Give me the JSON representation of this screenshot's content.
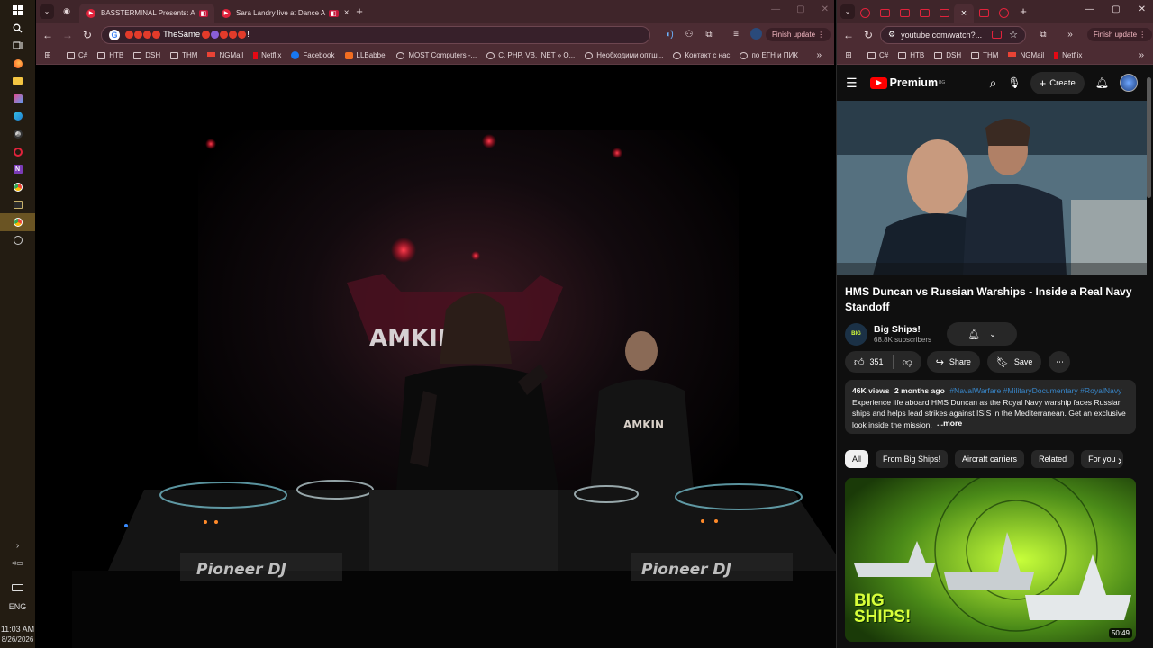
{
  "taskbar": {
    "icons": [
      "windows-start-icon",
      "search-icon",
      "task-view-icon",
      "firefox-icon",
      "file-explorer-icon",
      "photos-icon",
      "edge-icon",
      "chrome-dev-icon",
      "opera-icon",
      "onenote-icon",
      "chrome-icon",
      "terminal-icon",
      "chrome-active-icon",
      "settings-icon"
    ],
    "language": "ENG",
    "time": "11:03 AM",
    "date": "8/26/2026"
  },
  "left_browser": {
    "tabs": [
      {
        "title": "BASSTERMINAL Presents: A"
      },
      {
        "title": "Sara Landry live at Dance A"
      }
    ],
    "omnibox_prefix": "",
    "omnibox_text": "TheSame",
    "omnibox_suffix": "!",
    "finish_update": "Finish update",
    "bookmarks": [
      {
        "label": "C#",
        "icon": "folder"
      },
      {
        "label": "НТВ",
        "icon": "folder"
      },
      {
        "label": "DSH",
        "icon": "folder"
      },
      {
        "label": "THM",
        "icon": "folder"
      },
      {
        "label": "NGMail",
        "icon": "gmail"
      },
      {
        "label": "Netflix",
        "icon": "netflix"
      },
      {
        "label": "Facebook",
        "icon": "facebook"
      },
      {
        "label": "LLBabbel",
        "icon": "babbel"
      },
      {
        "label": "MOST Computers -...",
        "icon": "globe"
      },
      {
        "label": "C, PHP, VB, .NET » O...",
        "icon": "globe"
      },
      {
        "label": "Необходими оптш...",
        "icon": "globe"
      },
      {
        "label": "Контакт с нас",
        "icon": "globe"
      },
      {
        "label": "по ЕГН и ПИК",
        "icon": "globe"
      }
    ],
    "video": {
      "booth_logo": "AMKIN",
      "shirt_logo": "AMKIN",
      "deck_left": "Pioneer DJ",
      "deck_right": "Pioneer DJ"
    }
  },
  "right_browser": {
    "url": "youtube.com/watch?...",
    "finish_update": "Finish update",
    "bookmarks": [
      {
        "label": "C#",
        "icon": "folder"
      },
      {
        "label": "НТВ",
        "icon": "folder"
      },
      {
        "label": "DSH",
        "icon": "folder"
      },
      {
        "label": "THM",
        "icon": "folder"
      },
      {
        "label": "NGMail",
        "icon": "gmail"
      },
      {
        "label": "Netflix",
        "icon": "netflix"
      }
    ],
    "youtube": {
      "logo_text": "Premium",
      "logo_badge": "BG",
      "create_label": "Create",
      "title": "HMS Duncan vs Russian Warships - Inside a Real Navy Standoff",
      "channel_name": "Big Ships!",
      "channel_avatar": "BIG",
      "subscribers": "68.8K subscribers",
      "likes": "351",
      "share_label": "Share",
      "save_label": "Save",
      "views": "46K views",
      "age": "2 months ago",
      "hashtags": "#NavalWarfare #MilitaryDocumentary #RoyalNavy",
      "description": "Experience life aboard HMS Duncan as the Royal Navy warship faces Russian ships and helps lead strikes against ISIS in the Mediterranean. Get an exclusive look inside the mission.",
      "more_label": "...more",
      "chips": [
        "All",
        "From Big Ships!",
        "Aircraft carriers",
        "Related",
        "For you"
      ],
      "rec_thumb_text": "BIG SHIPS!",
      "rec_duration": "50:49"
    }
  },
  "colors": {
    "chrome_frame": "#3f252a",
    "chrome_toolbar": "#4c2c33",
    "yt_red": "#ff0000",
    "yt_bg": "#0f0f0f",
    "hashtag": "#3ea6ff"
  }
}
